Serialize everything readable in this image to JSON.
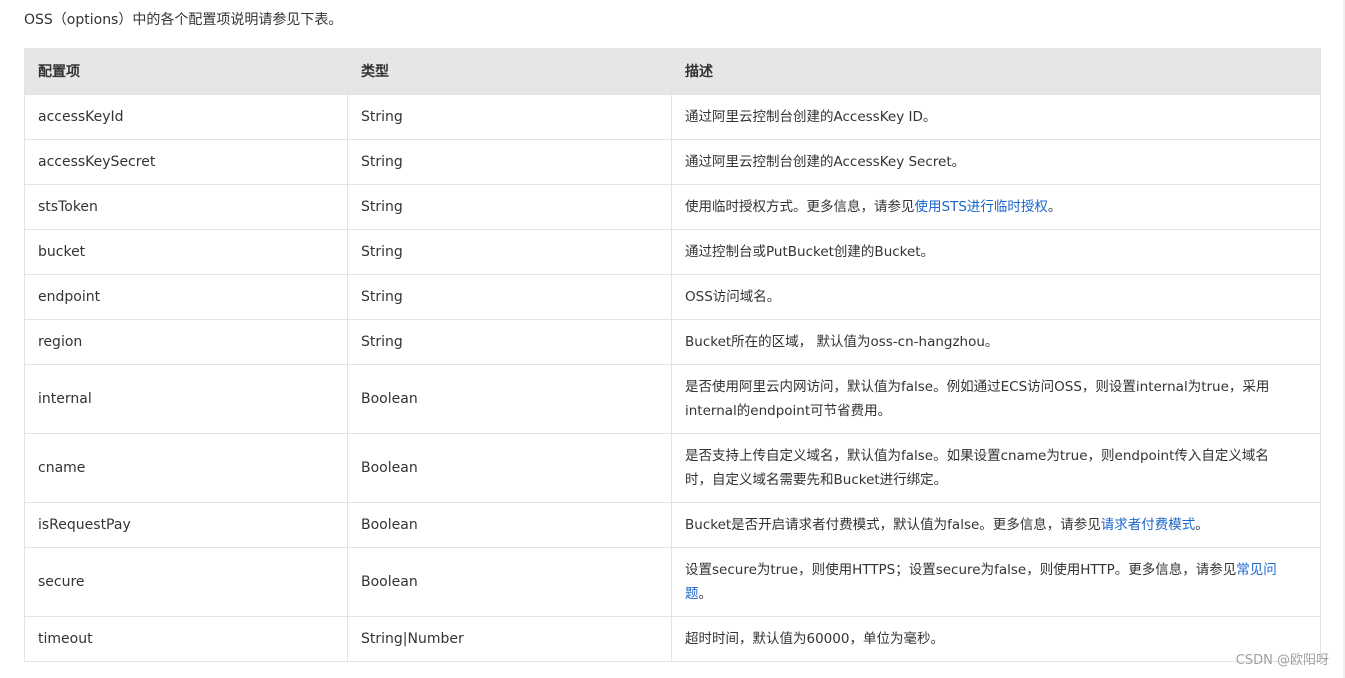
{
  "intro": "OSS（options）中的各个配置项说明请参见下表。",
  "table": {
    "headers": [
      "配置项",
      "类型",
      "描述"
    ],
    "rows": [
      {
        "name": "accessKeyId",
        "type": "String",
        "desc": "通过阿里云控制台创建的AccessKey ID。"
      },
      {
        "name": "accessKeySecret",
        "type": "String",
        "desc": "通过阿里云控制台创建的AccessKey Secret。"
      },
      {
        "name": "stsToken",
        "type": "String",
        "desc_before": "使用临时授权方式。更多信息，请参见",
        "desc_link": "使用STS进行临时授权",
        "desc_after": "。"
      },
      {
        "name": "bucket",
        "type": "String",
        "desc": "通过控制台或PutBucket创建的Bucket。"
      },
      {
        "name": "endpoint",
        "type": "String",
        "desc": "OSS访问域名。"
      },
      {
        "name": "region",
        "type": "String",
        "desc": "Bucket所在的区域， 默认值为oss-cn-hangzhou。"
      },
      {
        "name": "internal",
        "type": "Boolean",
        "desc_line1": "是否使用阿里云内网访问，默认值为false。例如通过ECS访问OSS，则设置internal为true，采用",
        "desc_line2": "internal的endpoint可节省费用。"
      },
      {
        "name": "cname",
        "type": "Boolean",
        "desc_line1": "是否支持上传自定义域名，默认值为false。如果设置cname为true，则endpoint传入自定义域名",
        "desc_line2": "时，自定义域名需要先和Bucket进行绑定。"
      },
      {
        "name": "isRequestPay",
        "type": "Boolean",
        "desc_before": "Bucket是否开启请求者付费模式，默认值为false。更多信息，请参见",
        "desc_link": "请求者付费模式",
        "desc_after": "。"
      },
      {
        "name": "secure",
        "type": "Boolean",
        "desc_before": "设置secure为true，则使用HTTPS；设置secure为false，则使用HTTP。更多信息，请参见",
        "desc_link_part1": "常见问",
        "desc_link_part2": "题",
        "desc_after": "。"
      },
      {
        "name": "timeout",
        "type": "String|Number",
        "desc": "超时时间，默认值为60000，单位为毫秒。"
      }
    ]
  },
  "watermark": "CSDN @欧阳呀"
}
